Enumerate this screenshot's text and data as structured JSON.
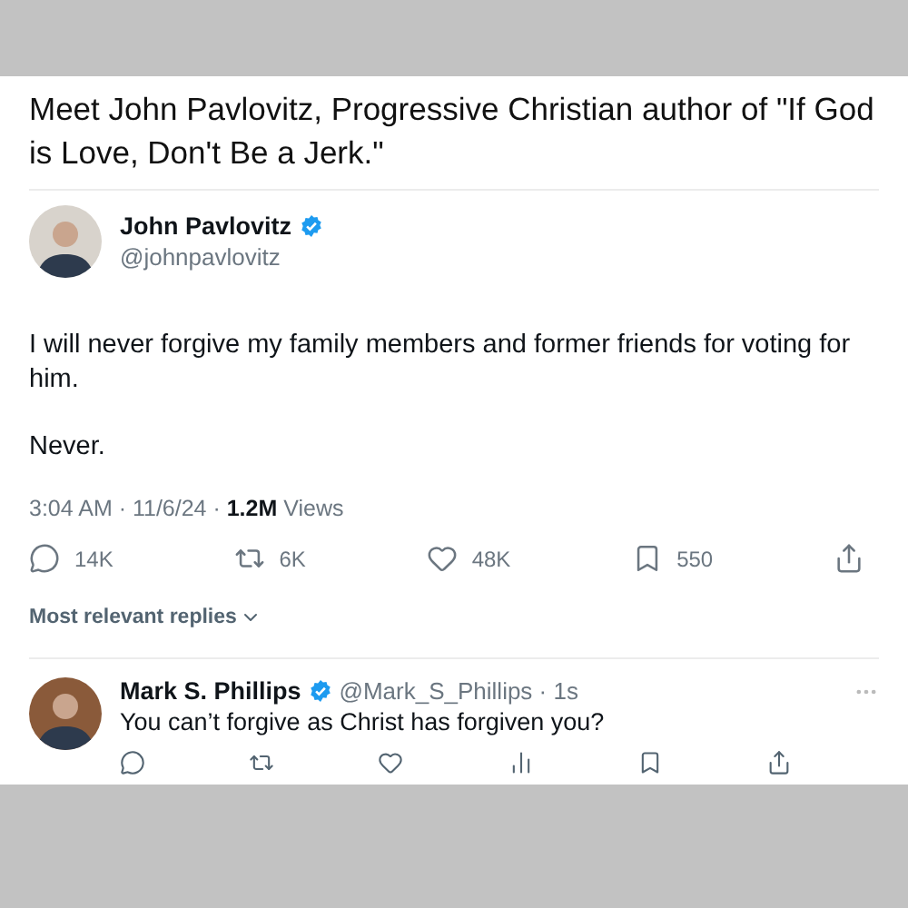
{
  "caption": "Meet John Pavlovitz, Progressive Christian author of \"If God is Love, Don't Be a Jerk.\"",
  "post": {
    "author": {
      "name": "John Pavlovitz",
      "handle": "@johnpavlovitz",
      "verified": true
    },
    "paragraphs": [
      "I will never forgive my family members and former friends for voting for him.",
      "Never."
    ],
    "meta": "3:04 AM · 11/6/24 · **1.2M** Views",
    "actions": [
      {
        "kind": "reply",
        "count": "14K"
      },
      {
        "kind": "repost",
        "count": "6K"
      },
      {
        "kind": "like",
        "count": "48K"
      },
      {
        "kind": "bookmark",
        "count": "550"
      },
      {
        "kind": "share"
      }
    ]
  },
  "replies_sort": "Most relevant replies",
  "reply": {
    "author": {
      "name": "Mark S. Phillips",
      "handle": "@Mark_S_Phillips · 1s",
      "verified": true
    },
    "text": "You can’t forgive as Christ has forgiven you?",
    "actions": [
      {
        "kind": "reply"
      },
      {
        "kind": "repost"
      },
      {
        "kind": "like"
      },
      {
        "kind": "views"
      },
      {
        "kind": "bookmark"
      },
      {
        "kind": "share"
      }
    ]
  }
}
